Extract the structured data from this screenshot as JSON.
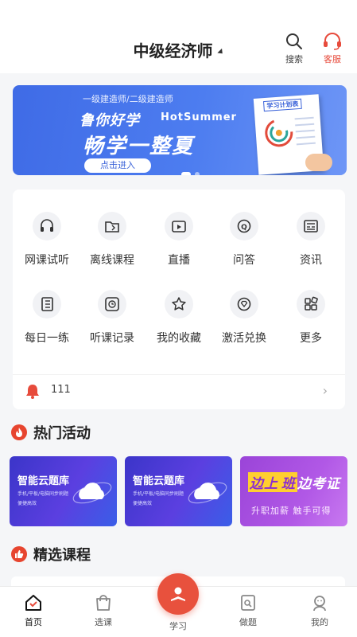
{
  "header": {
    "title": "中级经济师",
    "search_label": "搜索",
    "service_label": "客服",
    "accent": "#e74b3c"
  },
  "banner": {
    "subtitle": "一级建造师/二级建造师",
    "brand": "鲁你好学",
    "brand_en": "HotSummer",
    "headline": "畅学一整夏",
    "enter_label": "点击进入",
    "poster_title": "学习计划表",
    "slide_count": 2,
    "active_slide": 1
  },
  "menu": {
    "items": [
      {
        "label": "网课试听",
        "icon": "headphones-icon"
      },
      {
        "label": "离线课程",
        "icon": "folder-icon"
      },
      {
        "label": "直播",
        "icon": "live-icon"
      },
      {
        "label": "问答",
        "icon": "qa-icon"
      },
      {
        "label": "资讯",
        "icon": "news-icon"
      },
      {
        "label": "每日一练",
        "icon": "notebook-icon"
      },
      {
        "label": "听课记录",
        "icon": "clock-icon"
      },
      {
        "label": "我的收藏",
        "icon": "star-icon"
      },
      {
        "label": "激活兑换",
        "icon": "diamond-icon"
      },
      {
        "label": "更多",
        "icon": "grid-icon"
      }
    ],
    "notice": "111"
  },
  "hot": {
    "title": "热门活动",
    "cards": [
      {
        "title": "智能云题库",
        "line1": "手机/平板/电脑同步刷题",
        "line2": "便捷高效"
      },
      {
        "title": "智能云题库",
        "line1": "手机/平板/电脑同步刷题",
        "line2": "便捷高效"
      },
      {
        "title_a": "边上",
        "title_b": "班",
        "title_c": "边考证",
        "subtitle": "升职加薪 触手可得"
      }
    ]
  },
  "courses": {
    "title": "精选课程"
  },
  "tabbar": {
    "items": [
      {
        "label": "首页",
        "icon": "home-icon"
      },
      {
        "label": "选课",
        "icon": "bag-icon"
      },
      {
        "label": "学习",
        "icon": "study-icon"
      },
      {
        "label": "做题",
        "icon": "exam-icon"
      },
      {
        "label": "我的",
        "icon": "user-icon"
      }
    ],
    "active": 0
  }
}
